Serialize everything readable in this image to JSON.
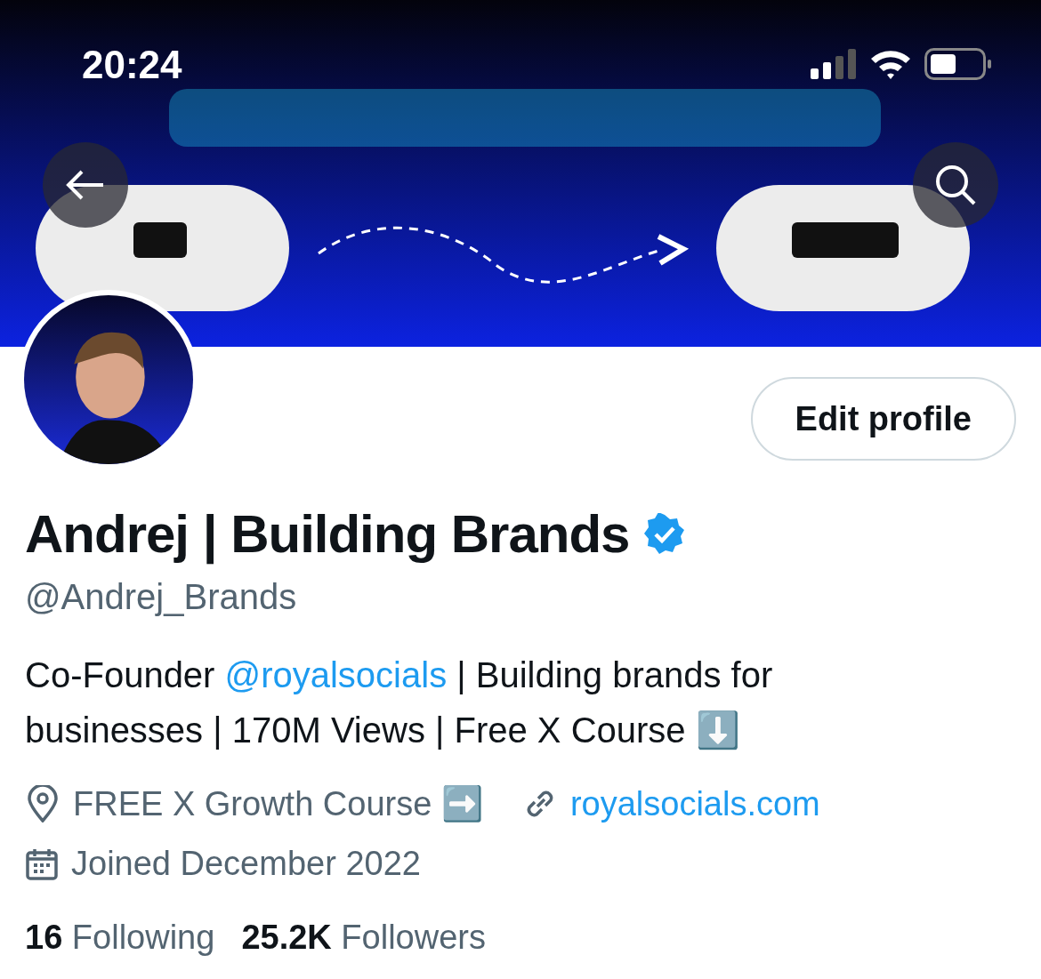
{
  "status_bar": {
    "time": "20:24"
  },
  "profile": {
    "edit_button": "Edit profile",
    "name": "Andrej | Building Brands",
    "verified": true,
    "handle": "@Andrej_Brands",
    "bio": [
      {
        "kind": "text",
        "text": "Co-Founder "
      },
      {
        "kind": "mention",
        "text": "@royalsocials"
      },
      {
        "kind": "text",
        "text": " | Building brands for businesses | 170M Views | Free X Course ⬇️"
      }
    ],
    "location": "FREE X Growth Course ➡️",
    "website": "royalsocials.com",
    "joined": "Joined December 2022",
    "stats": [
      {
        "count": "16",
        "label": "Following"
      },
      {
        "count": "25.2K",
        "label": "Followers"
      }
    ]
  }
}
